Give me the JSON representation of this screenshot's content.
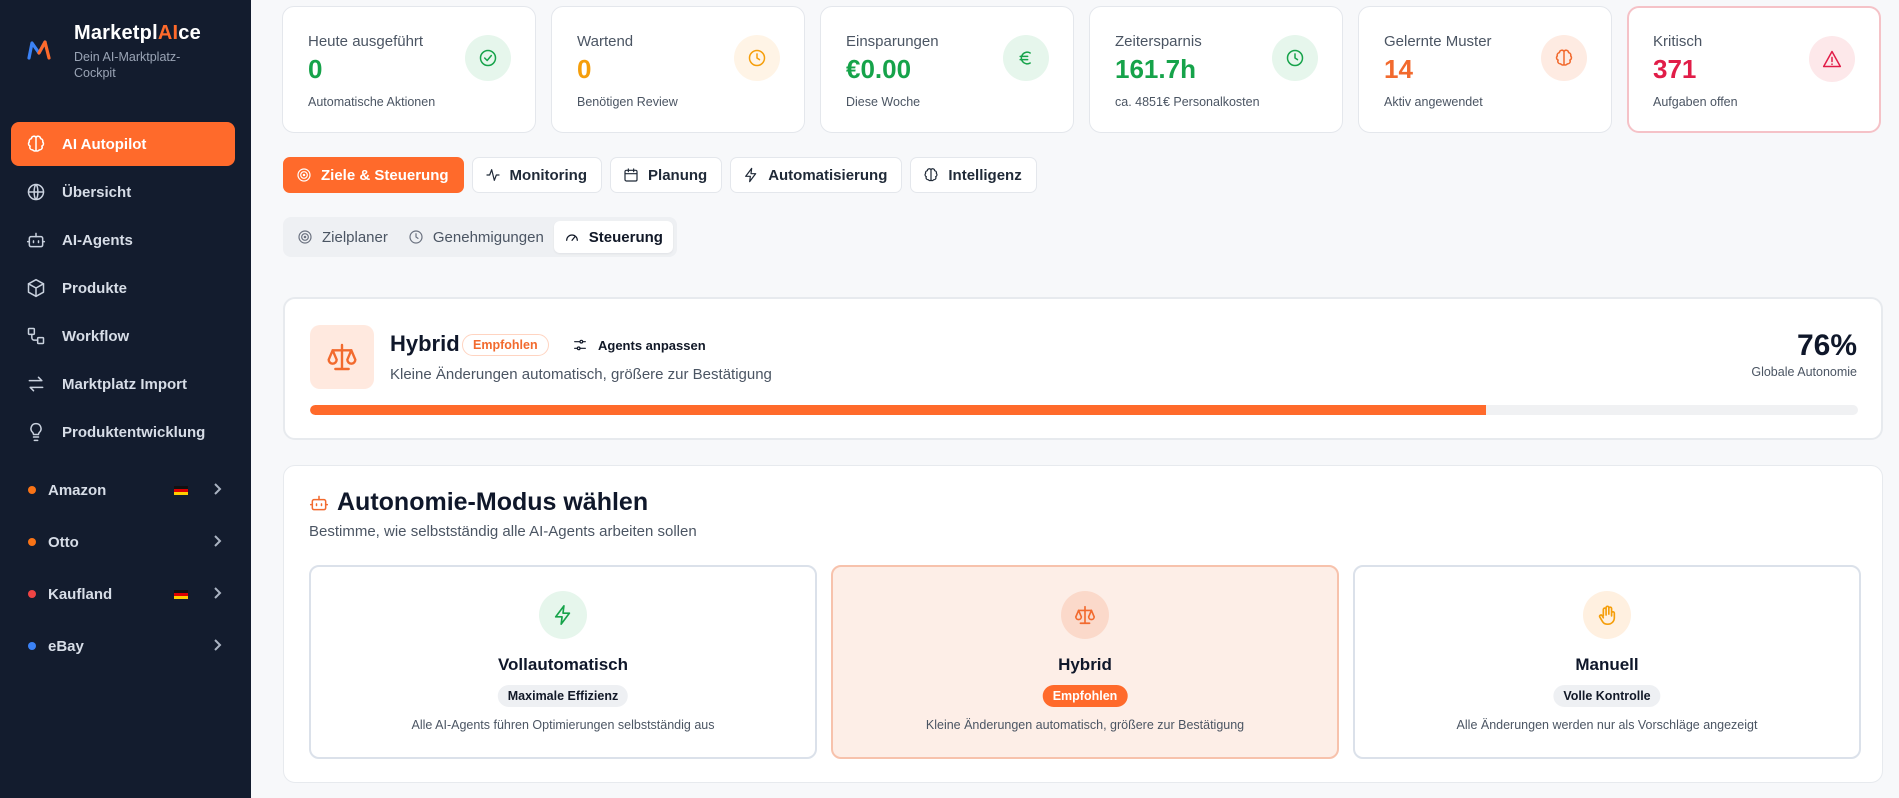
{
  "brand": {
    "name_prefix": "Marketpl",
    "name_ai": "AI",
    "name_suffix": "ce",
    "subtitle": "Dein AI-Marktplatz-Cockpit"
  },
  "nav": [
    {
      "label": "AI Autopilot",
      "icon": "brain-icon",
      "active": true
    },
    {
      "label": "Übersicht",
      "icon": "globe-icon"
    },
    {
      "label": "AI-Agents",
      "icon": "bot-icon"
    },
    {
      "label": "Produkte",
      "icon": "package-icon"
    },
    {
      "label": "Workflow",
      "icon": "workflow-icon"
    },
    {
      "label": "Marktplatz Import",
      "icon": "arrows-icon"
    },
    {
      "label": "Produktentwicklung",
      "icon": "lightbulb-icon"
    }
  ],
  "marketplaces": [
    {
      "label": "Amazon",
      "dot_color": "#f97316",
      "flag": true
    },
    {
      "label": "Otto",
      "dot_color": "#f97316",
      "flag": false
    },
    {
      "label": "Kaufland",
      "dot_color": "#ef4444",
      "flag": true
    },
    {
      "label": "eBay",
      "dot_color": "#3b82f6",
      "flag": false
    }
  ],
  "stats": [
    {
      "label": "Heute ausgeführt",
      "value": "0",
      "sub": "Automatische Aktionen",
      "color": "#16a34a",
      "icon_bg": "#e6f6ec",
      "icon": "check-circle-icon"
    },
    {
      "label": "Wartend",
      "value": "0",
      "sub": "Benötigen Review",
      "color": "#f59e0b",
      "icon_bg": "#fff4e6",
      "icon": "clock-icon"
    },
    {
      "label": "Einsparungen",
      "value": "€0.00",
      "sub": "Diese Woche",
      "color": "#16a34a",
      "icon_bg": "#e6f6ec",
      "icon": "euro-icon"
    },
    {
      "label": "Zeitersparnis",
      "value": "161.7h",
      "sub": "ca. 4851€ Personalkosten",
      "color": "#16a34a",
      "icon_bg": "#e6f6ec",
      "icon": "clock-icon"
    },
    {
      "label": "Gelernte Muster",
      "value": "14",
      "sub": "Aktiv angewendet",
      "color": "#f26a2e",
      "icon_bg": "#feebe2",
      "icon": "brain-icon"
    },
    {
      "label": "Kritisch",
      "value": "371",
      "sub": "Aufgaben offen",
      "color": "#e11d48",
      "icon_bg": "#fde8ea",
      "icon": "alert-triangle-icon"
    }
  ],
  "tabs": [
    {
      "label": "Ziele & Steuerung",
      "icon": "target-icon",
      "active": true
    },
    {
      "label": "Monitoring",
      "icon": "activity-icon"
    },
    {
      "label": "Planung",
      "icon": "calendar-icon"
    },
    {
      "label": "Automatisierung",
      "icon": "zap-icon"
    },
    {
      "label": "Intelligenz",
      "icon": "brain-icon"
    }
  ],
  "subtabs": [
    {
      "label": "Zielplaner",
      "icon": "target-icon"
    },
    {
      "label": "Genehmigungen",
      "icon": "clock-icon"
    },
    {
      "label": "Steuerung",
      "icon": "gauge-icon",
      "active": true
    }
  ],
  "status": {
    "title": "Hybrid",
    "badge": "Empfohlen",
    "adjust_label": "Agents anpassen",
    "description": "Kleine Änderungen automatisch, größere zur Bestätigung",
    "percent_label": "76%",
    "percent_value": 76,
    "percent_caption": "Globale Autonomie"
  },
  "mode": {
    "title": "Autonomie-Modus wählen",
    "subtitle": "Bestimme, wie selbstständig alle AI-Agents arbeiten sollen",
    "options": [
      {
        "title": "Vollautomatisch",
        "badge": "Maximale Effizienz",
        "desc": "Alle AI-Agents führen Optimierungen selbstständig aus",
        "icon": "zap-icon",
        "icon_color": "#16a34a",
        "icon_bg": "#e6f6ec",
        "selected": false
      },
      {
        "title": "Hybrid",
        "badge": "Empfohlen",
        "desc": "Kleine Änderungen automatisch, größere zur Bestätigung",
        "icon": "scale-icon",
        "icon_color": "#f26a2e",
        "icon_bg": "#fbd9ca",
        "selected": true
      },
      {
        "title": "Manuell",
        "badge": "Volle Kontrolle",
        "desc": "Alle Änderungen werden nur als Vorschläge angezeigt",
        "icon": "hand-icon",
        "icon_color": "#f59e0b",
        "icon_bg": "#fff0e0",
        "selected": false
      }
    ]
  },
  "accent": "#ff6a2b"
}
